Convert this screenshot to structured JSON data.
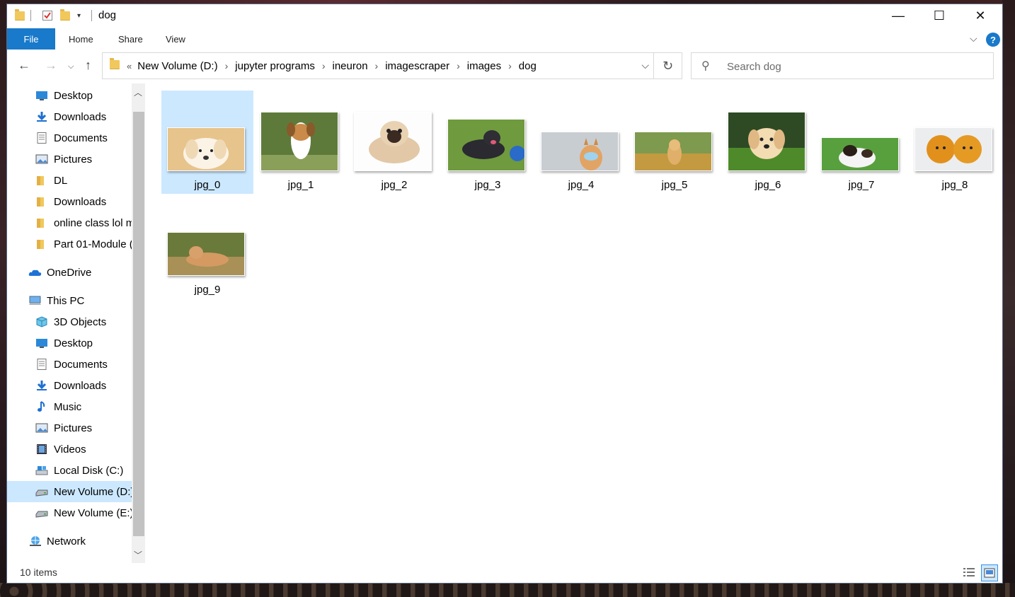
{
  "window": {
    "title": "dog"
  },
  "window_controls": {
    "minimize": "—",
    "maximize": "☐",
    "close": "✕"
  },
  "ribbon": {
    "file": "File",
    "home": "Home",
    "share": "Share",
    "view": "View"
  },
  "address": {
    "overflow": "«",
    "crumbs": [
      "New Volume (D:)",
      "jupyter programs",
      "ineuron",
      "imagescraper",
      "images",
      "dog"
    ]
  },
  "search": {
    "placeholder": "Search dog"
  },
  "nav": {
    "quick_access": [
      {
        "label": "Desktop",
        "icon": "desktop-icon",
        "pinned": true
      },
      {
        "label": "Downloads",
        "icon": "downloads-icon",
        "pinned": true
      },
      {
        "label": "Documents",
        "icon": "documents-icon",
        "pinned": true
      },
      {
        "label": "Pictures",
        "icon": "pictures-icon",
        "pinned": true
      },
      {
        "label": "DL",
        "icon": "folder-icon",
        "pinned": false
      },
      {
        "label": "Downloads",
        "icon": "folder-icon",
        "pinned": false
      },
      {
        "label": "online class lol m",
        "icon": "folder-icon",
        "pinned": false
      },
      {
        "label": "Part 01-Module (",
        "icon": "folder-icon",
        "pinned": false
      }
    ],
    "onedrive": "OneDrive",
    "this_pc": "This PC",
    "pc_items": [
      {
        "label": "3D Objects",
        "icon": "3d-objects-icon"
      },
      {
        "label": "Desktop",
        "icon": "desktop-icon"
      },
      {
        "label": "Documents",
        "icon": "documents-icon"
      },
      {
        "label": "Downloads",
        "icon": "downloads-icon"
      },
      {
        "label": "Music",
        "icon": "music-icon"
      },
      {
        "label": "Pictures",
        "icon": "pictures-icon"
      },
      {
        "label": "Videos",
        "icon": "videos-icon"
      },
      {
        "label": "Local Disk (C:)",
        "icon": "local-disk-icon"
      },
      {
        "label": "New Volume (D:)",
        "icon": "drive-icon",
        "selected": true
      },
      {
        "label": "New Volume (E:)",
        "icon": "drive-icon"
      }
    ],
    "network": "Network"
  },
  "files": [
    {
      "name": "jpg_0",
      "selected": true
    },
    {
      "name": "jpg_1"
    },
    {
      "name": "jpg_2"
    },
    {
      "name": "jpg_3"
    },
    {
      "name": "jpg_4"
    },
    {
      "name": "jpg_5"
    },
    {
      "name": "jpg_6"
    },
    {
      "name": "jpg_7"
    },
    {
      "name": "jpg_8"
    },
    {
      "name": "jpg_9"
    }
  ],
  "status": {
    "count": "10 items"
  },
  "colors": {
    "accent": "#1979ca",
    "selection": "#cce8ff"
  }
}
